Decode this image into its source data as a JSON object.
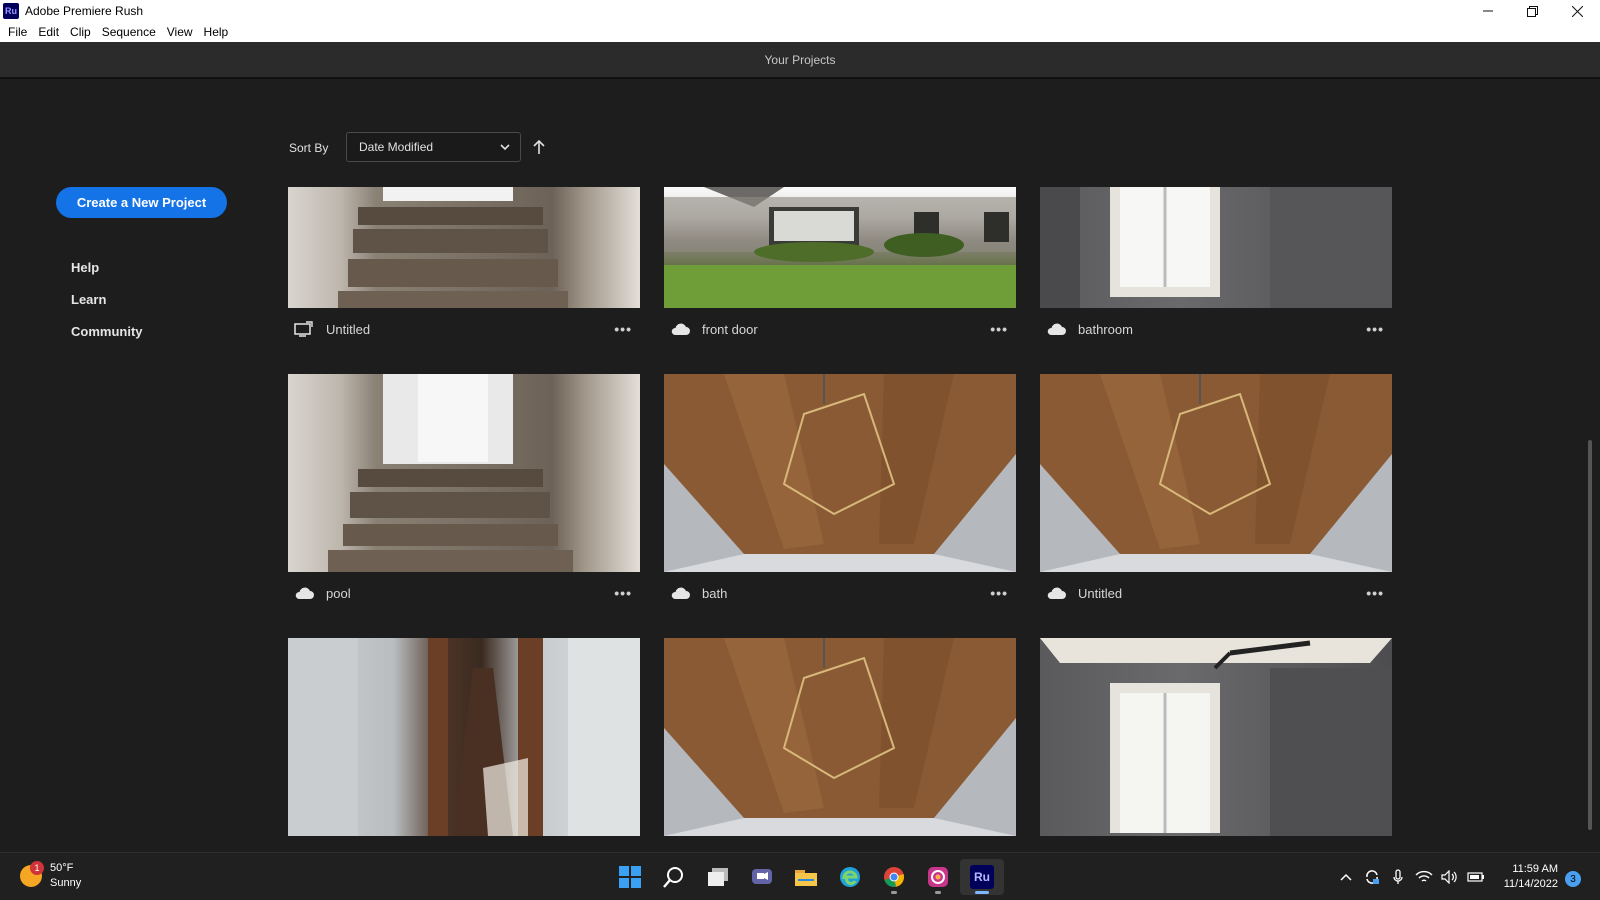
{
  "window": {
    "logo": "Ru",
    "title": "Adobe Premiere Rush",
    "controls": [
      "minimize-icon",
      "restore-icon",
      "close-icon"
    ]
  },
  "menu": [
    "File",
    "Edit",
    "Clip",
    "Sequence",
    "View",
    "Help"
  ],
  "header": {
    "title": "Your Projects"
  },
  "sidebar": {
    "create_label": "Create a New Project",
    "links": [
      "Help",
      "Learn",
      "Community"
    ]
  },
  "sort": {
    "label": "Sort By",
    "selected": "Date Modified",
    "direction_icon": "arrow-up-icon"
  },
  "projects": [
    {
      "name": "Untitled",
      "status": "local-sync-icon",
      "thumb": "stairs"
    },
    {
      "name": "front door",
      "status": "cloud-icon",
      "thumb": "house"
    },
    {
      "name": "bathroom",
      "status": "cloud-icon",
      "thumb": "room"
    },
    {
      "name": "pool",
      "status": "cloud-icon",
      "thumb": "stairs"
    },
    {
      "name": "bath",
      "status": "cloud-icon",
      "thumb": "ceiling"
    },
    {
      "name": "Untitled",
      "status": "cloud-icon",
      "thumb": "ceiling"
    },
    {
      "name": "",
      "status": "cloud-icon",
      "thumb": "hall"
    },
    {
      "name": "",
      "status": "cloud-icon",
      "thumb": "ceiling"
    },
    {
      "name": "",
      "status": "cloud-icon",
      "thumb": "room"
    }
  ],
  "more_label": "•••",
  "taskbar": {
    "weather": {
      "temp": "50°F",
      "condition": "Sunny",
      "badge": "1"
    },
    "apps": [
      "windows-start-icon",
      "search-icon",
      "task-view-icon",
      "teams-chat-icon",
      "file-explorer-icon",
      "edge-browser-icon",
      "chrome-browser-icon",
      "app-icon",
      "premiere-rush-icon"
    ],
    "rush_label": "Ru",
    "time": "11:59 AM",
    "date": "11/14/2022",
    "notifications": "3"
  }
}
